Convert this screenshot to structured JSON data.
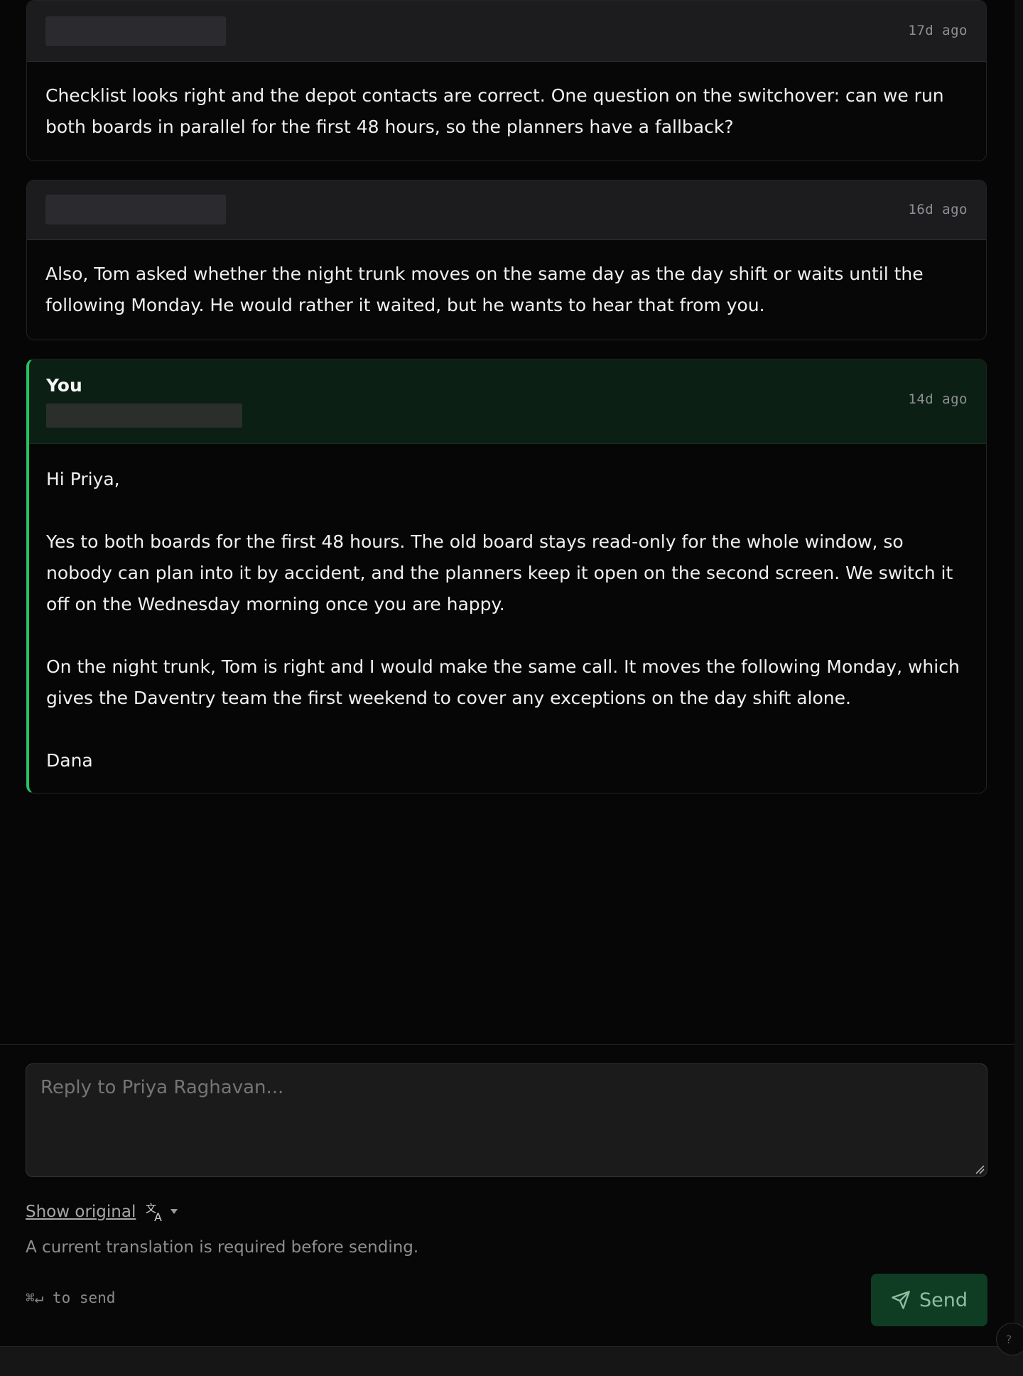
{
  "thread": {
    "messages": [
      {
        "time": "17d ago",
        "body": "Checklist looks right and the depot contacts are correct. One question on the switchover: can we run both boards in parallel for the first 48 hours, so the planners have a fallback?"
      },
      {
        "time": "16d ago",
        "body": "Also, Tom asked whether the night trunk moves on the same day as the day shift or waits until the following Monday. He would rather it waited, but he wants to hear that from you."
      },
      {
        "sender": "You",
        "time": "14d ago",
        "body": "Hi Priya,\n\nYes to both boards for the first 48 hours. The old board stays read-only for the whole window, so nobody can plan into it by accident, and the planners keep it open on the second screen. We switch it off on the Wednesday morning once you are happy.\n\nOn the night trunk, Tom is right and I would make the same call. It moves the following Monday, which gives the Daventry team the first weekend to cover any exceptions on the day shift alone.\n\nDana"
      }
    ]
  },
  "composer": {
    "placeholder": "Reply to Priya Raghavan...",
    "value": "",
    "show_original": "Show original",
    "translate_icon": "translate-icon",
    "hint": "A current translation is required before sending.",
    "shortcut": "⌘↵ to send",
    "send_label": "Send",
    "help_label": "?"
  },
  "colors": {
    "accent": "#22c55e",
    "send_bg": "#0f3d24"
  }
}
